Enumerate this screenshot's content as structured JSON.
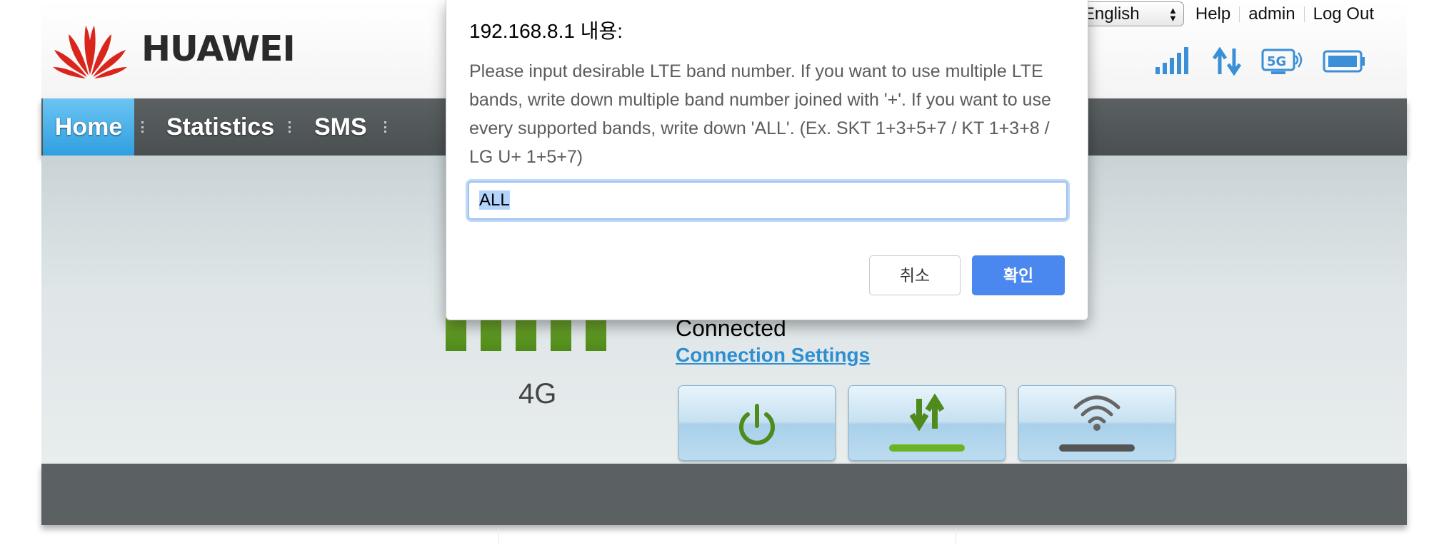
{
  "brand": {
    "name": "HUAWEI"
  },
  "top_links": {
    "language": "English",
    "help": "Help",
    "user": "admin",
    "logout": "Log Out"
  },
  "status_icons": [
    "signal-strength-icon",
    "data-transfer-icon",
    "5g-icon",
    "battery-icon"
  ],
  "nav": {
    "home": "Home",
    "statistics": "Statistics",
    "sms": "SMS"
  },
  "connection": {
    "network_type": "4G",
    "status": "Connected",
    "settings_link": "Connection Settings",
    "signal_bars": 5
  },
  "action_buttons": [
    "power-icon",
    "data-toggle-icon",
    "wifi-icon"
  ],
  "dialog": {
    "title": "192.168.8.1 내용:",
    "message": "Please input desirable LTE band number. If you want to use multiple LTE bands, write down multiple band number joined with '+'. If you want to use every supported bands, write down 'ALL'. (Ex. SKT 1+3+5+7 / KT 1+3+8 / LG U+ 1+5+7)",
    "input_value": "ALL",
    "cancel_label": "취소",
    "ok_label": "확인"
  },
  "colors": {
    "nav_bg": "#4f5557",
    "nav_active": "#3aa8e6",
    "accent_green": "#5e9a22",
    "link_blue": "#2e8fd0",
    "ok_button": "#4a87ee"
  }
}
